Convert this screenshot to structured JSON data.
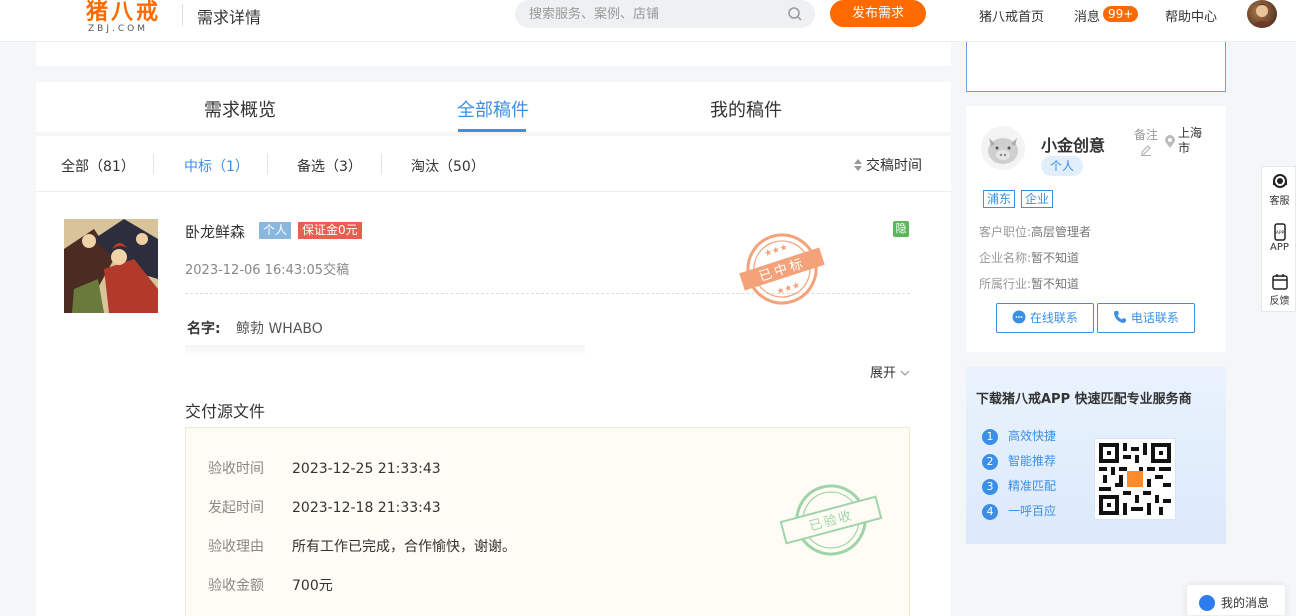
{
  "header": {
    "logo_cn": "猪八戒",
    "logo_en": "ZBJ.COM",
    "page_title": "需求详情",
    "search_placeholder": "搜索服务、案例、店铺",
    "publish_label": "发布需求",
    "nav_home": "猪八戒首页",
    "nav_messages": "消息",
    "messages_badge": "99+",
    "nav_help": "帮助中心"
  },
  "tabs": [
    {
      "label": "需求概览",
      "active": false
    },
    {
      "label": "全部稿件",
      "active": true
    },
    {
      "label": "我的稿件",
      "active": false
    }
  ],
  "filters": [
    {
      "label": "全部（81）",
      "active": false
    },
    {
      "label": "中标（1）",
      "active": true
    },
    {
      "label": "备选（3）",
      "active": false
    },
    {
      "label": "淘汰（50）",
      "active": false
    }
  ],
  "sort_label": "交稿时间",
  "submission": {
    "seller_name": "卧龙鲜森",
    "tag_personal": "个人",
    "tag_deposit": "保证金0元",
    "hidden_badge": "隐",
    "submit_time": "2023-12-06 16:43:05交稿",
    "stamp_text": "已中标",
    "field_label": "名字:",
    "field_value": "鲸勃  WHABO",
    "expand_label": "展开",
    "section_title": "交付源文件",
    "delivery": {
      "stamp_text": "已验收",
      "rows": [
        {
          "label": "验收时间",
          "value": "2023-12-25 21:33:43"
        },
        {
          "label": "发起时间",
          "value": "2023-12-18 21:33:43"
        },
        {
          "label": "验收理由",
          "value": "所有工作已完成，合作愉快，谢谢。"
        },
        {
          "label": "验收金额",
          "value": "700元"
        }
      ]
    }
  },
  "buyer": {
    "name": "小金创意",
    "type": "个人",
    "note_label": "备注",
    "location": "上海市",
    "tags": [
      "浦东",
      "企业"
    ],
    "info": [
      {
        "label": "客户职位:",
        "value": "高层管理者"
      },
      {
        "label": "企业名称:",
        "value": "暂不知道"
      },
      {
        "label": "所属行业:",
        "value": "暂不知道"
      }
    ],
    "online_contact": "在线联系",
    "phone_contact": "电话联系"
  },
  "app_promo": {
    "title": "下载猪八戒APP 快速匹配专业服务商",
    "features": [
      {
        "num": "1",
        "label": "高效快捷"
      },
      {
        "num": "2",
        "label": "智能推荐"
      },
      {
        "num": "3",
        "label": "精准匹配"
      },
      {
        "num": "4",
        "label": "一呼百应"
      }
    ]
  },
  "float_bar": [
    {
      "label": "客服",
      "icon": "customer-service-icon"
    },
    {
      "label": "APP",
      "icon": "app-icon"
    },
    {
      "label": "反馈",
      "icon": "feedback-icon"
    }
  ],
  "my_messages": "我的消息",
  "colors": {
    "brand_orange": "#ff6a00",
    "accent_blue": "#3c8fe6",
    "stamp_orange": "#f08a5a",
    "stamp_green": "#7cc48a"
  }
}
